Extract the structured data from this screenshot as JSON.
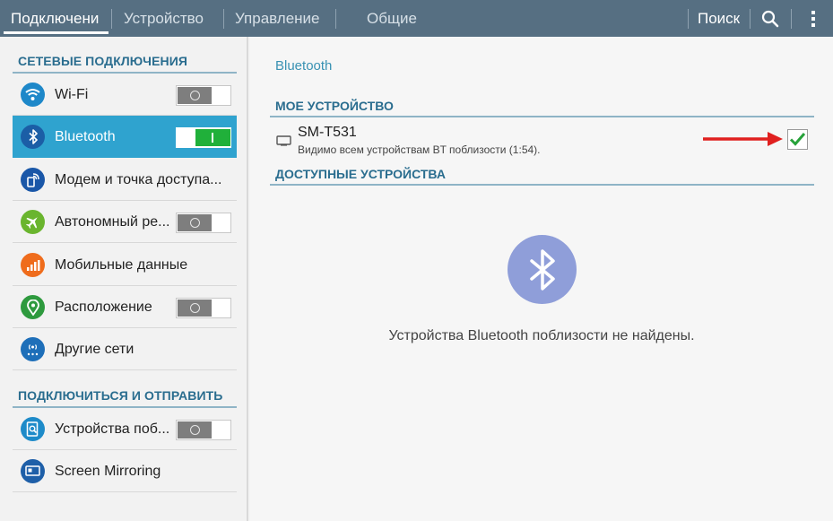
{
  "topbar": {
    "tabs": [
      "Подключени",
      "Устройство",
      "Управление",
      "Общие"
    ],
    "search_label": "Поиск",
    "search_icon": "search-icon",
    "menu_icon": "more-vertical-icon"
  },
  "sidebar": {
    "section1": "СЕТЕВЫЕ ПОДКЛЮЧЕНИЯ",
    "section2": "ПОДКЛЮЧИТЬСЯ И ОТПРАВИТЬ",
    "items": [
      {
        "label": "Wi-Fi",
        "icon": "wifi-icon",
        "color": "#1e88c9",
        "toggle": "off"
      },
      {
        "label": "Bluetooth",
        "icon": "bluetooth-icon",
        "color": "#1b5ea6",
        "toggle": "on",
        "selected": true
      },
      {
        "label": "Модем и точка доступа...",
        "icon": "hotspot-icon",
        "color": "#1a57a8"
      },
      {
        "label": "Автономный ре...",
        "icon": "airplane-icon",
        "color": "#6ab52e",
        "toggle": "off"
      },
      {
        "label": "Мобильные данные",
        "icon": "mobile-data-icon",
        "color": "#ef6c1c"
      },
      {
        "label": "Расположение",
        "icon": "location-icon",
        "color": "#2e9a3e",
        "toggle": "off"
      },
      {
        "label": "Другие сети",
        "icon": "other-networks-icon",
        "color": "#1e6fb9"
      },
      {
        "label": "Устройства поб...",
        "icon": "nearby-devices-icon",
        "color": "#1e8bc9",
        "toggle": "off"
      },
      {
        "label": "Screen Mirroring",
        "icon": "screen-mirroring-icon",
        "color": "#1e5fa8"
      }
    ]
  },
  "main": {
    "title": "Bluetooth",
    "my_device_header": "МОЕ УСТРОЙСТВО",
    "device_name": "SM-T531",
    "device_status": "Видимо всем устройствам BT поблизости (1:54).",
    "device_checked": true,
    "available_header": "ДОСТУПНЫЕ УСТРОЙСТВА",
    "empty_message": "Устройства Bluetooth поблизости не найдены."
  },
  "colors": {
    "topbar": "#566f82",
    "accent": "#2fa3cf",
    "section_text": "#2a6d8f",
    "toggle_on": "#20b03a",
    "arrow": "#e0201f"
  }
}
